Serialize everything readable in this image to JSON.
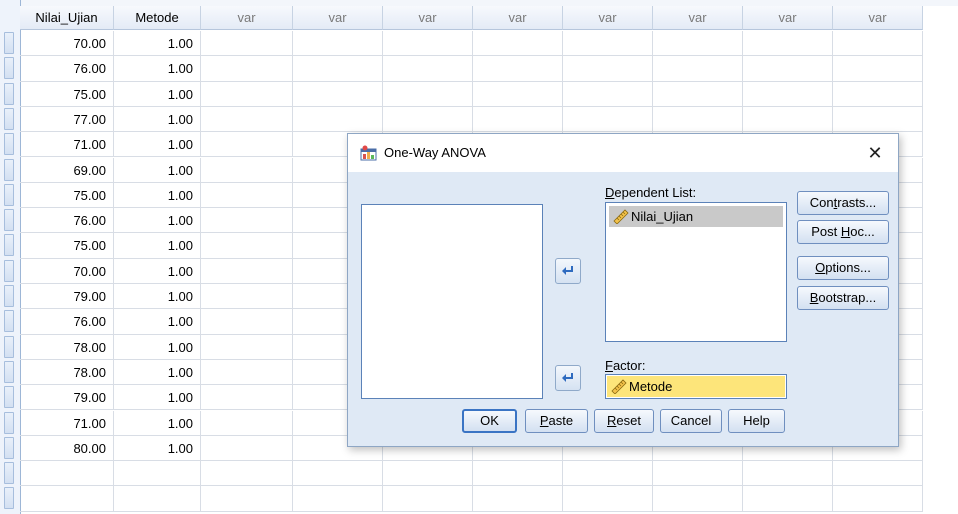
{
  "grid": {
    "columns": [
      "Nilai_Ujian",
      "Metode",
      "var",
      "var",
      "var",
      "var",
      "var",
      "var",
      "var",
      "var"
    ],
    "rows": [
      [
        "70.00",
        "1.00"
      ],
      [
        "76.00",
        "1.00"
      ],
      [
        "75.00",
        "1.00"
      ],
      [
        "77.00",
        "1.00"
      ],
      [
        "71.00",
        "1.00"
      ],
      [
        "69.00",
        "1.00"
      ],
      [
        "75.00",
        "1.00"
      ],
      [
        "76.00",
        "1.00"
      ],
      [
        "75.00",
        "1.00"
      ],
      [
        "70.00",
        "1.00"
      ],
      [
        "79.00",
        "1.00"
      ],
      [
        "76.00",
        "1.00"
      ],
      [
        "78.00",
        "1.00"
      ],
      [
        "78.00",
        "1.00"
      ],
      [
        "79.00",
        "1.00"
      ],
      [
        "71.00",
        "1.00"
      ],
      [
        "80.00",
        "1.00"
      ]
    ]
  },
  "dialog": {
    "title": "One-Way ANOVA",
    "close_glyph": "✕",
    "dependent_label_u": "D",
    "dependent_label_rest": "ependent List:",
    "dependent_items": [
      "Nilai_Ujian"
    ],
    "factor_label_u": "F",
    "factor_label_rest": "actor:",
    "factor_value": "Metode",
    "side_buttons": [
      {
        "pre": "Con",
        "u": "t",
        "post": "rasts..."
      },
      {
        "pre": "Post ",
        "u": "H",
        "post": "oc..."
      },
      {
        "pre": "",
        "u": "O",
        "post": "ptions..."
      },
      {
        "pre": "",
        "u": "B",
        "post": "ootstrap..."
      }
    ],
    "ok": "OK",
    "paste_u": "P",
    "paste_rest": "aste",
    "reset_u": "R",
    "reset_rest": "eset",
    "cancel": "Cancel",
    "help": "Help"
  },
  "colors": {
    "accent": "#3a74c4",
    "factor_highlight": "#fde57a",
    "selected_item": "#c9c9c9",
    "dialog_bg": "#dfe9f5"
  },
  "icons": [
    "dialog-app-icon",
    "ruler-scale-icon",
    "move-arrow-icon",
    "close-icon"
  ]
}
